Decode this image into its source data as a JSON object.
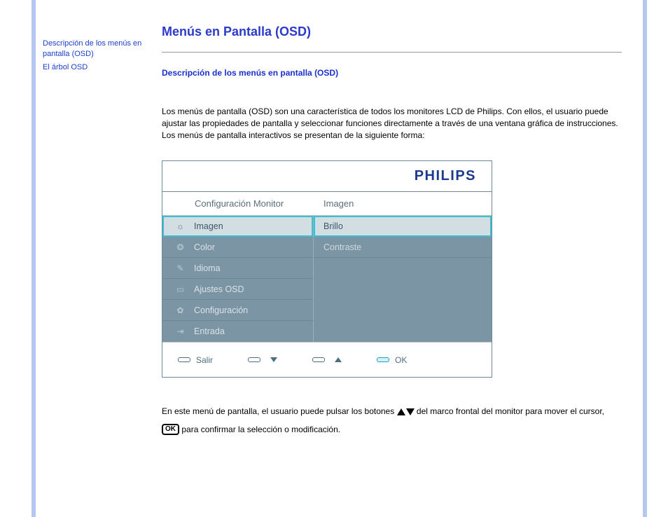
{
  "sidebar": {
    "links": [
      "Descripción de los menús en pantalla (OSD)",
      "El árbol OSD"
    ]
  },
  "title": "Menús en Pantalla (OSD)",
  "subtitle": "Descripción de los menús en pantalla (OSD)",
  "intro": "Los menús de pantalla (OSD) son una característica de todos los monitores LCD de Philips. Con ellos, el usuario puede ajustar las propiedades de pantalla y seleccionar funciones directamente a través de una ventana gráfica de instrucciones. Los menús de pantalla interactivos se presentan de la siguiente forma:",
  "osd": {
    "brand": "PHILIPS",
    "header_left": "Configuración Monitor",
    "header_right": "Imagen",
    "menu": [
      {
        "label": "Imagen",
        "icon": "brightness-icon",
        "glyph": "☼",
        "selected": true
      },
      {
        "label": "Color",
        "icon": "globe-icon",
        "glyph": "❂",
        "selected": false
      },
      {
        "label": "Idioma",
        "icon": "language-icon",
        "glyph": "✎",
        "selected": false
      },
      {
        "label": "Ajustes OSD",
        "icon": "screen-icon",
        "glyph": "▭",
        "selected": false
      },
      {
        "label": "Configuración",
        "icon": "gear-icon",
        "glyph": "✿",
        "selected": false
      },
      {
        "label": "Entrada",
        "icon": "input-icon",
        "glyph": "⇥",
        "selected": false
      }
    ],
    "submenu": [
      {
        "label": "Brillo",
        "selected": true
      },
      {
        "label": "Contraste",
        "selected": false
      }
    ],
    "buttons": {
      "exit": "Salir",
      "ok": "OK"
    }
  },
  "footer": {
    "part1": "En este menú de pantalla, el usuario puede pulsar los botones ",
    "part2": " del marco frontal del monitor para mover el cursor, ",
    "ok_glyph": "OK",
    "part3": " para confirmar la selección o modificación."
  }
}
